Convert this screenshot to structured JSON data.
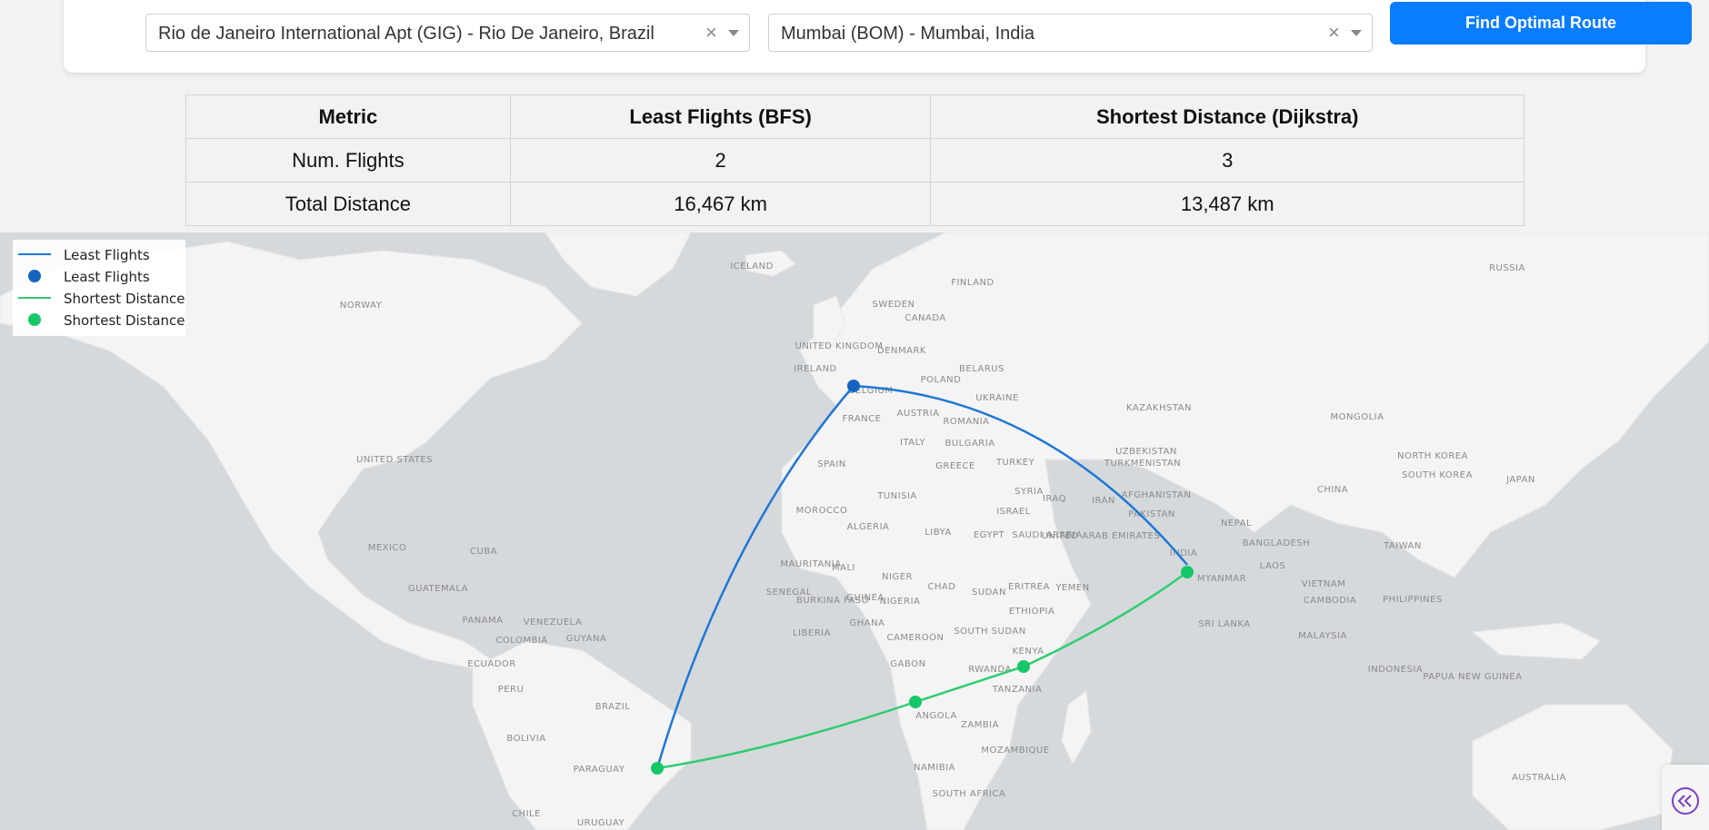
{
  "search": {
    "origin_value": "Rio de Janeiro International Apt (GIG) - Rio De Janeiro, Brazil",
    "destination_value": "Mumbai (BOM) - Mumbai, India",
    "clear_glyph": "×",
    "find_button_label": "Find Optimal Route",
    "accent_color": "#0a7cff"
  },
  "table": {
    "headers": [
      "Metric",
      "Least Flights (BFS)",
      "Shortest Distance (Dijkstra)"
    ],
    "rows": [
      [
        "Num. Flights",
        "2",
        "3"
      ],
      [
        "Total Distance",
        "16,467 km",
        "13,487 km"
      ]
    ]
  },
  "legend": {
    "items": [
      {
        "label": "Least Flights",
        "symbol": "line",
        "color": "#1f77d4"
      },
      {
        "label": "Least Flights",
        "symbol": "dot",
        "color": "#1565c0"
      },
      {
        "label": "Shortest Distance",
        "symbol": "line",
        "color": "#2ecc71"
      },
      {
        "label": "Shortest Distance",
        "symbol": "dot",
        "color": "#16c768"
      }
    ]
  },
  "map": {
    "land_color": "#f4f4f4",
    "water_color": "#d5d9dc",
    "labels": [
      "ICELAND",
      "FINLAND",
      "RUSSIA",
      "NORWAY",
      "SWEDEN",
      "CANADA",
      "UNITED KINGDOM",
      "IRELAND",
      "DENMARK",
      "BELARUS",
      "POLAND",
      "BELGIUM",
      "UKRAINE",
      "KAZAKHSTAN",
      "MONGOLIA",
      "FRANCE",
      "AUSTRIA",
      "ROMANIA",
      "ITALY",
      "BULGARIA",
      "UNITED STATES",
      "SPAIN",
      "GREECE",
      "TURKEY",
      "UZBEKISTAN",
      "TURKMENISTAN",
      "NORTH KOREA",
      "SOUTH KOREA",
      "JAPAN",
      "SYRIA",
      "IRAQ",
      "IRAN",
      "AFGHANISTAN",
      "CHINA",
      "TUNISIA",
      "MOROCCO",
      "ISRAEL",
      "PAKISTAN",
      "NEPAL",
      "ALGERIA",
      "LIBYA",
      "EGYPT",
      "SAUDI ARABIA",
      "UNITED ARAB EMIRATES",
      "BANGLADESH",
      "INDIA",
      "TAIWAN",
      "MEXICO",
      "CUBA",
      "MAURITANIA",
      "MALI",
      "NIGER",
      "CHAD",
      "SUDAN",
      "ERITREA",
      "YEMEN",
      "MYANMAR",
      "LAOS",
      "VIETNAM",
      "GUATEMALA",
      "SENEGAL",
      "BURKINA FASO",
      "GUINEA",
      "NIGERIA",
      "ETHIOPIA",
      "CAMBODIA",
      "PHILIPPINES",
      "PANAMA",
      "VENEZUELA",
      "GHANA",
      "LIBERIA",
      "CAMEROON",
      "SOUTH SUDAN",
      "SRI LANKA",
      "COLOMBIA",
      "GUYANA",
      "MALAYSIA",
      "GABON",
      "RWANDA",
      "KENYA",
      "ECUADOR",
      "INDONESIA",
      "PAPUA NEW GUINEA",
      "TANZANIA",
      "PERU",
      "BRAZIL",
      "ANGOLA",
      "ZAMBIA",
      "BOLIVIA",
      "MOZAMBIQUE",
      "PARAGUAY",
      "NAMIBIA",
      "AUSTRALIA",
      "SOUTH AFRICA",
      "CHILE",
      "URUGUAY"
    ],
    "routes": {
      "least_flights": {
        "color": "#1f77d4",
        "stops": [
          "GIG",
          "Brussels (BRU)",
          "BOM"
        ]
      },
      "shortest_distance": {
        "color": "#2ecc71",
        "stops": [
          "GIG",
          "Luanda",
          "Nairobi",
          "BOM"
        ]
      }
    }
  },
  "collapse_button": {
    "icon": "double-chevron-left-icon",
    "color": "#7b3fc4"
  }
}
